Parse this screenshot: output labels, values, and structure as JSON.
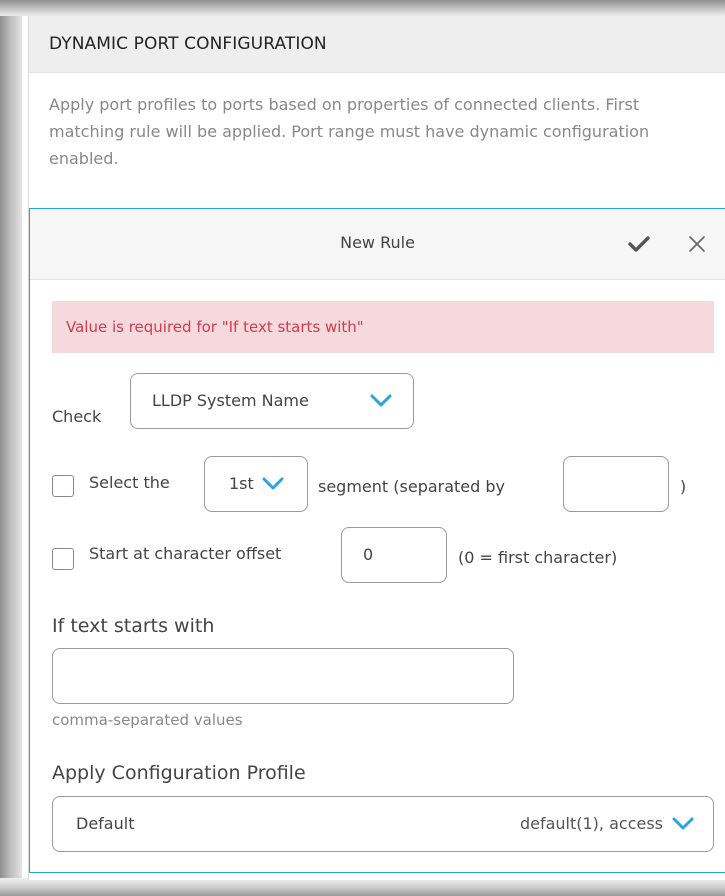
{
  "panel": {
    "title": "DYNAMIC PORT CONFIGURATION",
    "description": "Apply port profiles to ports based on properties of connected clients. First matching rule will be applied. Port range must have dynamic configuration enabled."
  },
  "rule": {
    "title": "New Rule",
    "error": "Value is required for \"If text starts with\"",
    "check_label": "Check",
    "check_value": "LLDP System Name",
    "select_label": "Select the",
    "segment_value": "1st",
    "segment_text": "segment (separated by",
    "separator_value": "",
    "close_paren": ")",
    "offset_label": "Start at character offset",
    "offset_value": "0",
    "offset_hint": "(0 = first character)",
    "starts_with_label": "If text starts with",
    "starts_with_value": "",
    "starts_with_hint": "comma-separated values",
    "profile_label": "Apply Configuration Profile",
    "profile_name": "Default",
    "profile_detail": "default(1), access"
  },
  "colors": {
    "accent": "#2aa4e0",
    "error_bg": "#f6d9dc",
    "error_text": "#d23c4e"
  },
  "icons": {
    "confirm": "checkmark-icon",
    "close": "close-icon",
    "dropdown": "chevron-down-icon"
  }
}
